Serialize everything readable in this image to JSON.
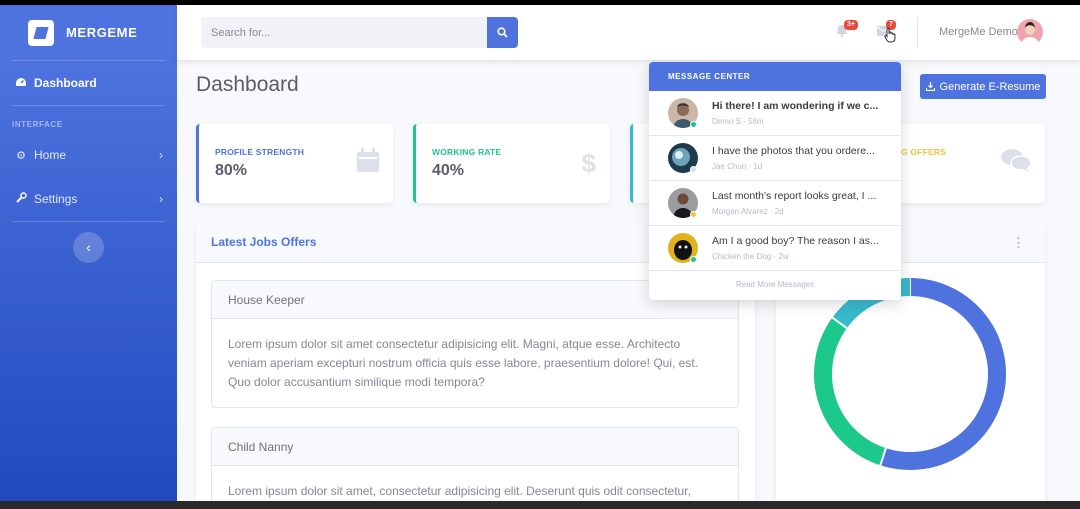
{
  "sidebar": {
    "brand": "MERGEME",
    "heading": "INTERFACE",
    "items": [
      {
        "label": "Dashboard",
        "icon": "tachometer-icon",
        "active": true
      },
      {
        "label": "Home",
        "icon": "cog-icon"
      },
      {
        "label": "Settings",
        "icon": "wrench-icon"
      }
    ],
    "toggle_glyph": "‹"
  },
  "topbar": {
    "search_placeholder": "Search for...",
    "alerts_badge": "3+",
    "messages_badge": "7",
    "user_name": "MergeMe Demo"
  },
  "page": {
    "title": "Dashboard",
    "generate_button": "Generate E-Resume"
  },
  "stats": [
    {
      "label": "PROFILE STRENGTH",
      "value": "80%",
      "color": "#4e73df",
      "icon": "calendar-icon"
    },
    {
      "label": "WORKING RATE",
      "value": "40%",
      "color": "#1cc88a",
      "icon": "dollar-icon"
    },
    {
      "label": "",
      "value": "",
      "color": "#36b9cc",
      "icon": ""
    },
    {
      "label": "G OFFERS",
      "value": "",
      "color": "#f6c23e",
      "icon": "comments-icon"
    }
  ],
  "jobs": {
    "header": "Latest Jobs Offers",
    "items": [
      {
        "title": "House Keeper",
        "body": "Lorem ipsum dolor sit amet consectetur adipisicing elit. Magni, atque esse. Architecto veniam aperiam excepturi nostrum officia quis esse labore, praesentium dolore! Qui, est. Quo dolor accusantium similique modi tempora?"
      },
      {
        "title": "Child Nanny",
        "body": "Lorem ipsum dolor sit amet, consectetur adipisicing elit. Deserunt quis odit consectetur,"
      }
    ]
  },
  "donut": {
    "segments": [
      {
        "value": 55,
        "color": "#4e73df"
      },
      {
        "value": 30,
        "color": "#1cc88a"
      },
      {
        "value": 15,
        "color": "#36b9cc"
      }
    ]
  },
  "messages": {
    "header": "MESSAGE CENTER",
    "items": [
      {
        "text": "Hi there! I am wondering if we c...",
        "meta": "Demo S · 58m",
        "bold": true,
        "status": "#1cc88a",
        "bg": "#c9b7a7"
      },
      {
        "text": "I have the photos that you ordere...",
        "meta": "Jae Chun · 1d",
        "bold": false,
        "status": "#dddfeb",
        "bg": "#1e3a4c"
      },
      {
        "text": "Last month's report looks great, I ...",
        "meta": "Morgan Alvarez · 2d",
        "bold": false,
        "status": "#f6c23e",
        "bg": "#6b6e74"
      },
      {
        "text": "Am I a good boy? The reason I as...",
        "meta": "Chicken the Dog · 2w",
        "bold": false,
        "status": "#1cc88a",
        "bg": "#e2b21c"
      }
    ],
    "footer": "Read More Messages"
  }
}
